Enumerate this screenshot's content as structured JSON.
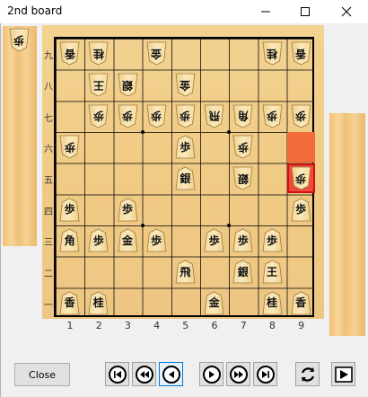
{
  "window": {
    "title": "2nd board"
  },
  "board": {
    "rank_labels": [
      "九",
      "八",
      "七",
      "六",
      "五",
      "四",
      "三",
      "二",
      "一"
    ],
    "file_labels": [
      "1",
      "2",
      "3",
      "4",
      "5",
      "6",
      "7",
      "8",
      "9"
    ],
    "pieces": [
      {
        "file": 1,
        "rank": 1,
        "char": "香",
        "owner": "gote"
      },
      {
        "file": 2,
        "rank": 1,
        "char": "桂",
        "owner": "gote"
      },
      {
        "file": 4,
        "rank": 1,
        "char": "金",
        "owner": "gote"
      },
      {
        "file": 8,
        "rank": 1,
        "char": "桂",
        "owner": "gote"
      },
      {
        "file": 9,
        "rank": 1,
        "char": "香",
        "owner": "gote"
      },
      {
        "file": 2,
        "rank": 2,
        "char": "王",
        "owner": "gote"
      },
      {
        "file": 3,
        "rank": 2,
        "char": "銀",
        "owner": "gote"
      },
      {
        "file": 5,
        "rank": 2,
        "char": "金",
        "owner": "gote"
      },
      {
        "file": 2,
        "rank": 3,
        "char": "歩",
        "owner": "gote"
      },
      {
        "file": 3,
        "rank": 3,
        "char": "歩",
        "owner": "gote"
      },
      {
        "file": 4,
        "rank": 3,
        "char": "歩",
        "owner": "gote"
      },
      {
        "file": 5,
        "rank": 3,
        "char": "歩",
        "owner": "gote"
      },
      {
        "file": 6,
        "rank": 3,
        "char": "飛",
        "owner": "gote"
      },
      {
        "file": 7,
        "rank": 3,
        "char": "角",
        "owner": "gote"
      },
      {
        "file": 8,
        "rank": 3,
        "char": "歩",
        "owner": "gote"
      },
      {
        "file": 9,
        "rank": 3,
        "char": "歩",
        "owner": "gote"
      },
      {
        "file": 1,
        "rank": 4,
        "char": "歩",
        "owner": "gote"
      },
      {
        "file": 5,
        "rank": 4,
        "char": "歩",
        "owner": "sente"
      },
      {
        "file": 7,
        "rank": 4,
        "char": "歩",
        "owner": "gote"
      },
      {
        "file": 5,
        "rank": 5,
        "char": "銀",
        "owner": "sente"
      },
      {
        "file": 7,
        "rank": 5,
        "char": "銀",
        "owner": "gote"
      },
      {
        "file": 9,
        "rank": 5,
        "char": "歩",
        "owner": "gote"
      },
      {
        "file": 1,
        "rank": 6,
        "char": "歩",
        "owner": "sente"
      },
      {
        "file": 3,
        "rank": 6,
        "char": "歩",
        "owner": "sente"
      },
      {
        "file": 9,
        "rank": 6,
        "char": "歩",
        "owner": "sente"
      },
      {
        "file": 1,
        "rank": 7,
        "char": "角",
        "owner": "sente"
      },
      {
        "file": 2,
        "rank": 7,
        "char": "歩",
        "owner": "sente"
      },
      {
        "file": 3,
        "rank": 7,
        "char": "金",
        "owner": "sente"
      },
      {
        "file": 4,
        "rank": 7,
        "char": "歩",
        "owner": "sente"
      },
      {
        "file": 6,
        "rank": 7,
        "char": "歩",
        "owner": "sente"
      },
      {
        "file": 7,
        "rank": 7,
        "char": "歩",
        "owner": "sente"
      },
      {
        "file": 8,
        "rank": 7,
        "char": "歩",
        "owner": "sente"
      },
      {
        "file": 5,
        "rank": 8,
        "char": "飛",
        "owner": "sente"
      },
      {
        "file": 7,
        "rank": 8,
        "char": "銀",
        "owner": "sente"
      },
      {
        "file": 8,
        "rank": 8,
        "char": "王",
        "owner": "sente"
      },
      {
        "file": 1,
        "rank": 9,
        "char": "香",
        "owner": "sente"
      },
      {
        "file": 2,
        "rank": 9,
        "char": "桂",
        "owner": "sente"
      },
      {
        "file": 6,
        "rank": 9,
        "char": "金",
        "owner": "sente"
      },
      {
        "file": 8,
        "rank": 9,
        "char": "桂",
        "owner": "sente"
      },
      {
        "file": 9,
        "rank": 9,
        "char": "香",
        "owner": "sente"
      }
    ],
    "last_move_from": {
      "file": 9,
      "rank": 4
    },
    "last_move_to": {
      "file": 9,
      "rank": 5
    }
  },
  "hands": {
    "gote": [
      {
        "char": "歩",
        "count": 1
      }
    ],
    "sente": []
  },
  "controls": {
    "close_label": "Close",
    "nav": [
      {
        "name": "first-move-button",
        "icon": "skip-to-start-icon"
      },
      {
        "name": "back-10-button",
        "icon": "fast-rewind-icon"
      },
      {
        "name": "back-1-button",
        "icon": "step-back-icon"
      },
      {
        "name": "forward-1-button",
        "icon": "step-forward-icon"
      },
      {
        "name": "forward-10-button",
        "icon": "fast-forward-icon"
      },
      {
        "name": "last-move-button",
        "icon": "skip-to-end-icon"
      },
      {
        "name": "flip-board-button",
        "icon": "rotate-arrows-icon"
      },
      {
        "name": "play-button",
        "icon": "play-icon"
      }
    ]
  }
}
